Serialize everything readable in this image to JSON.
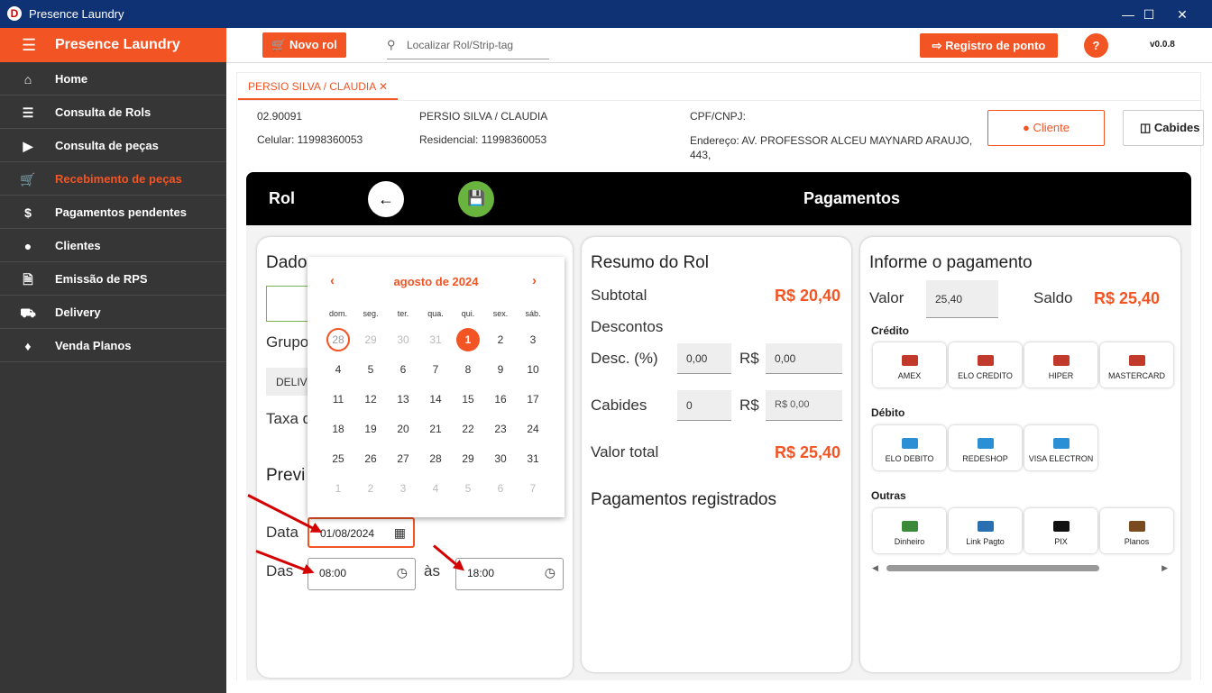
{
  "window": {
    "title": "Presence Laundry"
  },
  "sidebar": {
    "brand": "Presence Laundry",
    "items": [
      {
        "label": "Home",
        "icon": "home-icon"
      },
      {
        "label": "Consulta de Rols",
        "icon": "list-check-icon"
      },
      {
        "label": "Consulta de peças",
        "icon": "tag-icon"
      },
      {
        "label": "Recebimento de peças",
        "icon": "cart-icon",
        "active": true
      },
      {
        "label": "Pagamentos pendentes",
        "icon": "dollar-circle-icon"
      },
      {
        "label": "Clientes",
        "icon": "person-icon"
      },
      {
        "label": "Emissão de RPS",
        "icon": "document-export-icon"
      },
      {
        "label": "Delivery",
        "icon": "truck-icon"
      },
      {
        "label": "Venda Planos",
        "icon": "plan-icon"
      }
    ]
  },
  "topbar": {
    "new_rol": "Novo rol",
    "search_placeholder": "Localizar Rol/Strip-tag",
    "registro": "Registro de ponto",
    "help": "?",
    "version": "v0.0.8"
  },
  "tab": {
    "label": "PERSIO SILVA / CLAUDIA"
  },
  "customer": {
    "code": "02.90091",
    "celular": "Celular: 11998360053",
    "name": "PERSIO SILVA / CLAUDIA",
    "residencial": "Residencial: 11998360053",
    "cpf": "CPF/CNPJ:",
    "endereco": "Endereço: AV. PROFESSOR ALCEU MAYNARD ARAUJO, 443,",
    "cliente_btn": "Cliente",
    "cabides_btn": "Cabides"
  },
  "header": {
    "rol": "Rol",
    "title": "Pagamentos"
  },
  "left_panel": {
    "title": "Dado",
    "grupo": "Grupo",
    "group_value": "DELIVE",
    "taxa": "Taxa d",
    "previsao": "Previ",
    "data_label": "Data",
    "data_value": "01/08/2024",
    "das_label": "Das",
    "das_value": "08:00",
    "as_label": "às",
    "as_value": "18:00"
  },
  "calendar": {
    "month": "agosto de 2024",
    "weekdays": [
      "dom.",
      "seg.",
      "ter.",
      "qua.",
      "qui.",
      "sex.",
      "sáb."
    ],
    "weeks": [
      [
        "28",
        "29",
        "30",
        "31",
        "1",
        "2",
        "3"
      ],
      [
        "4",
        "5",
        "6",
        "7",
        "8",
        "9",
        "10"
      ],
      [
        "11",
        "12",
        "13",
        "14",
        "15",
        "16",
        "17"
      ],
      [
        "18",
        "19",
        "20",
        "21",
        "22",
        "23",
        "24"
      ],
      [
        "25",
        "26",
        "27",
        "28",
        "29",
        "30",
        "31"
      ],
      [
        "1",
        "2",
        "3",
        "4",
        "5",
        "6",
        "7"
      ]
    ]
  },
  "resumo": {
    "title": "Resumo do Rol",
    "subtotal_label": "Subtotal",
    "subtotal": "R$ 20,40",
    "descontos": "Descontos",
    "desc_pct_label": "Desc. (%)",
    "desc_pct": "0,00",
    "rs": "R$",
    "desc_val": "0,00",
    "cabides_label": "Cabides",
    "cabides_qty": "0",
    "cabides_val": "R$ 0,00",
    "total_label": "Valor total",
    "total": "R$ 25,40",
    "registrados": "Pagamentos registrados"
  },
  "pagamento": {
    "title": "Informe o pagamento",
    "valor_label": "Valor",
    "valor": "25,40",
    "saldo_label": "Saldo",
    "saldo": "R$ 25,40",
    "credito": "Crédito",
    "credito_items": [
      "AMEX",
      "ELO CREDITO",
      "HIPER",
      "MASTERCARD"
    ],
    "debito": "Débito",
    "debito_items": [
      "ELO DEBITO",
      "REDESHOP",
      "VISA ELECTRON"
    ],
    "outras": "Outras",
    "outras_items": [
      "Dinheiro",
      "Link Pagto",
      "PIX",
      "Planos"
    ]
  },
  "colors": {
    "accent": "#f25424",
    "sidebar": "#363636",
    "titlebar": "#0f3275",
    "save": "#69b33f"
  }
}
